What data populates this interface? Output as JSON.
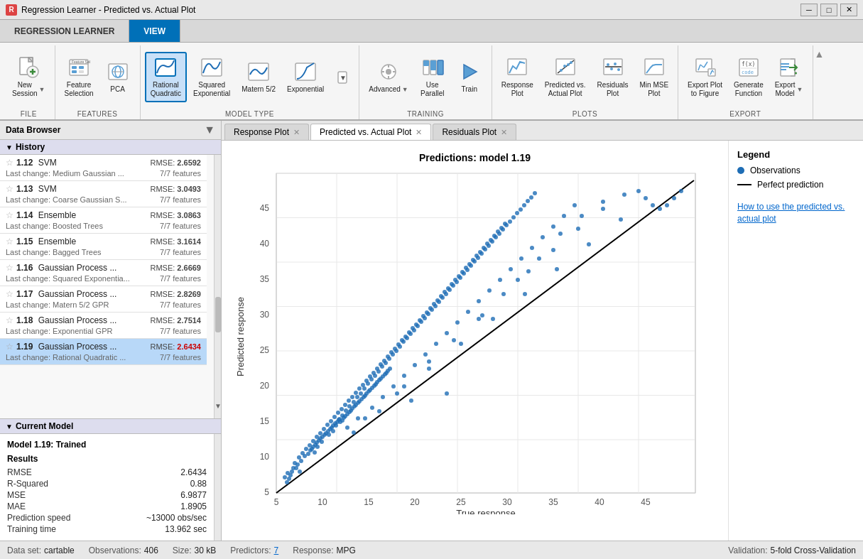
{
  "titleBar": {
    "icon": "R",
    "title": "Regression Learner - Predicted vs. Actual Plot",
    "controls": [
      "minimize",
      "maximize",
      "close"
    ]
  },
  "appTabs": [
    {
      "id": "regression-learner",
      "label": "REGRESSION LEARNER",
      "active": false
    },
    {
      "id": "view",
      "label": "VIEW",
      "active": true
    }
  ],
  "toolbar": {
    "groups": [
      {
        "id": "file",
        "label": "FILE",
        "buttons": [
          {
            "id": "new-session",
            "label": "New\nSession",
            "hasDropdown": true
          }
        ]
      },
      {
        "id": "features",
        "label": "FEATURES",
        "buttons": [
          {
            "id": "feature-selection",
            "label": "Feature\nSelection"
          },
          {
            "id": "pca",
            "label": "PCA"
          }
        ]
      },
      {
        "id": "model-type",
        "label": "MODEL TYPE",
        "buttons": [
          {
            "id": "rational-quadratic",
            "label": "Rational\nQuadratic",
            "active": true
          },
          {
            "id": "squared-exponential",
            "label": "Squared\nExponential"
          },
          {
            "id": "matern-52",
            "label": "Matern 5/2"
          },
          {
            "id": "exponential",
            "label": "Exponential"
          },
          {
            "id": "more-models",
            "label": "▼"
          }
        ]
      },
      {
        "id": "training",
        "label": "TRAINING",
        "buttons": [
          {
            "id": "advanced",
            "label": "Advanced",
            "hasDropdown": true
          },
          {
            "id": "use-parallel",
            "label": "Use\nParallel"
          },
          {
            "id": "train",
            "label": "Train"
          }
        ]
      },
      {
        "id": "plots",
        "label": "PLOTS",
        "buttons": [
          {
            "id": "response-plot",
            "label": "Response\nPlot"
          },
          {
            "id": "predicted-actual-plot",
            "label": "Predicted vs.\nActual Plot"
          },
          {
            "id": "residuals-plot",
            "label": "Residuals\nPlot"
          },
          {
            "id": "min-mse-plot",
            "label": "Min MSE\nPlot"
          }
        ]
      },
      {
        "id": "export",
        "label": "EXPORT",
        "buttons": [
          {
            "id": "export-plot-to-figure",
            "label": "Export Plot\nto Figure"
          },
          {
            "id": "generate-function",
            "label": "Generate\nFunction"
          },
          {
            "id": "export-model",
            "label": "Export\nModel",
            "hasDropdown": true
          }
        ]
      }
    ]
  },
  "leftPanel": {
    "title": "Data Browser",
    "history": {
      "label": "History",
      "items": [
        {
          "id": "1.12",
          "type": "SVM",
          "rmse": "2.6592",
          "change": "Medium Gaussian ...",
          "features": "7/7 features",
          "selected": false,
          "highlight": false
        },
        {
          "id": "1.13",
          "type": "SVM",
          "rmse": "3.0493",
          "change": "Coarse Gaussian S...",
          "features": "7/7 features",
          "selected": false,
          "highlight": false
        },
        {
          "id": "1.14",
          "type": "Ensemble",
          "rmse": "3.0863",
          "change": "Boosted Trees",
          "features": "7/7 features",
          "selected": false,
          "highlight": false
        },
        {
          "id": "1.15",
          "type": "Ensemble",
          "rmse": "3.1614",
          "change": "Bagged Trees",
          "features": "7/7 features",
          "selected": false,
          "highlight": false
        },
        {
          "id": "1.16",
          "type": "Gaussian Process ...",
          "rmse": "2.6669",
          "change": "Squared Exponentia...",
          "features": "7/7 features",
          "selected": false,
          "highlight": false
        },
        {
          "id": "1.17",
          "type": "Gaussian Process ...",
          "rmse": "2.8269",
          "change": "Matern 5/2 GPR",
          "features": "7/7 features",
          "selected": false,
          "highlight": false
        },
        {
          "id": "1.18",
          "type": "Gaussian Process ...",
          "rmse": "2.7514",
          "change": "Exponential GPR",
          "features": "7/7 features",
          "selected": false,
          "highlight": false
        },
        {
          "id": "1.19",
          "type": "Gaussian Process ...",
          "rmse": "2.6434",
          "change": "Rational Quadratic ...",
          "features": "7/7 features",
          "selected": true,
          "highlight": true
        }
      ]
    },
    "currentModel": {
      "label": "Current Model",
      "title": "Model 1.19: Trained",
      "resultsLabel": "Results",
      "metrics": [
        {
          "key": "RMSE",
          "val": "2.6434"
        },
        {
          "key": "R-Squared",
          "val": "0.88"
        },
        {
          "key": "MSE",
          "val": "6.9877"
        },
        {
          "key": "MAE",
          "val": "1.8905"
        },
        {
          "key": "Prediction speed",
          "val": "~13000 obs/sec"
        },
        {
          "key": "Training time",
          "val": "13.962 sec"
        }
      ]
    }
  },
  "plotTabs": [
    {
      "id": "response-plot",
      "label": "Response Plot",
      "closeable": true,
      "active": false
    },
    {
      "id": "predicted-actual-plot",
      "label": "Predicted vs. Actual Plot",
      "closeable": true,
      "active": true
    },
    {
      "id": "residuals-plot",
      "label": "Residuals Plot",
      "closeable": true,
      "active": false
    }
  ],
  "plot": {
    "title": "Predictions: model 1.19",
    "xAxis": "True response",
    "yAxis": "Predicted response",
    "xRange": [
      5,
      50
    ],
    "yRange": [
      5,
      50
    ],
    "xTicks": [
      10,
      15,
      20,
      25,
      30,
      35,
      40,
      45
    ],
    "yTicks": [
      10,
      15,
      20,
      25,
      30,
      35,
      40,
      45
    ]
  },
  "legend": {
    "title": "Legend",
    "items": [
      {
        "id": "observations",
        "type": "dot",
        "label": "Observations"
      },
      {
        "id": "perfect-prediction",
        "type": "line",
        "label": "Perfect prediction"
      }
    ],
    "helpLink": "How to use the predicted vs. actual plot"
  },
  "statusBar": {
    "dataset": "cartable",
    "observations": "406",
    "size": "30 kB",
    "predictors": "7",
    "response": "MPG",
    "validation": "5-fold Cross-Validation"
  }
}
